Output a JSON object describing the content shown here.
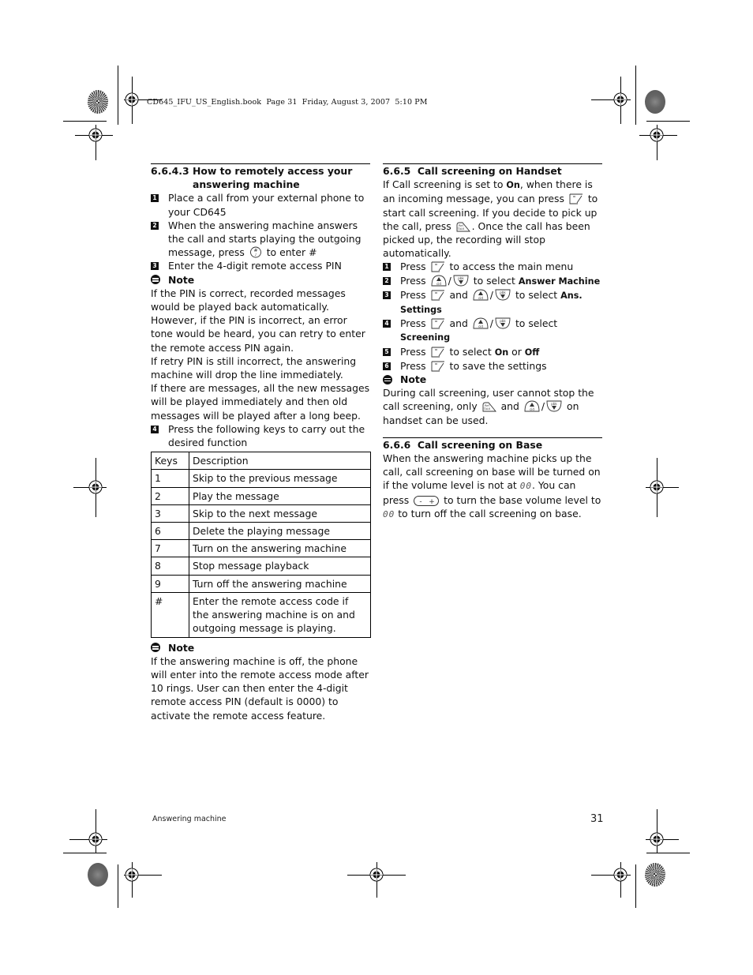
{
  "slug": "CD645_IFU_US_English.book  Page 31  Friday, August 3, 2007  5:10 PM",
  "left": {
    "section_number": "6.6.4.3",
    "section_title": "How to remotely access your answering machine",
    "steps": [
      {
        "n": "1",
        "text": "Place a call from your external phone to your CD645"
      },
      {
        "n": "2",
        "text_before": "When the answering machine answers the call and starts playing the outgoing message, press",
        "icon": "hash-key-icon",
        "text_after": "to enter #"
      },
      {
        "n": "3",
        "text": "Enter the 4-digit remote access PIN"
      }
    ],
    "note1": {
      "label": "Note",
      "paragraphs": [
        "If the PIN is correct, recorded messages would be played back automatically.",
        "However, if the PIN is incorrect, an error tone would be heard, you can retry to enter the remote access PIN again.",
        "If retry PIN is still incorrect, the answering machine will drop the line immediately.",
        "If there are messages, all the new messages will be played immediately and then old messages will be played after a long beep."
      ]
    },
    "step4": {
      "n": "4",
      "text": "Press the following keys to carry out the desired function"
    },
    "table": {
      "headers": [
        "Keys",
        "Description"
      ],
      "rows": [
        [
          "1",
          "Skip to the previous message"
        ],
        [
          "2",
          "Play the message"
        ],
        [
          "3",
          "Skip to the next message"
        ],
        [
          "6",
          "Delete the playing message"
        ],
        [
          "7",
          "Turn on the answering machine"
        ],
        [
          "8",
          "Stop message playback"
        ],
        [
          "9",
          "Turn off the answering machine"
        ],
        [
          "#",
          "Enter the remote access code if the answering machine is on and outgoing message is playing."
        ]
      ]
    },
    "note2": {
      "label": "Note",
      "text": "If the answering machine is off, the phone will enter into the remote access mode after 10 rings. User can then enter the 4-digit remote access PIN (default is 0000) to activate the remote access feature."
    }
  },
  "right": {
    "s665": {
      "number": "6.6.5",
      "title": "Call screening on Handset",
      "intro": {
        "t1": "If Call screening is set to ",
        "b1": "On",
        "t2": ", when there is an incoming message, you can press ",
        "t3": " to start call screening. If you decide to pick up the call, press ",
        "t4": ". Once the call has been picked up, the recording will stop automatically."
      },
      "steps": [
        {
          "n": "1",
          "a": "Press",
          "b": "to access the main menu"
        },
        {
          "n": "2",
          "a": "Press",
          "b": "to select",
          "bold": "Answer Machine"
        },
        {
          "n": "3",
          "a": "Press",
          "and": "and",
          "b": "to select",
          "bold": "Ans. Settings"
        },
        {
          "n": "4",
          "a": "Press",
          "and": "and",
          "b": "to select",
          "bold": "Screening"
        },
        {
          "n": "5",
          "a": "Press",
          "b": "to select",
          "bold1": "On",
          "or": "or",
          "bold2": "Off"
        },
        {
          "n": "6",
          "a": "Press",
          "b": "to save the settings"
        }
      ],
      "note": {
        "label": "Note",
        "t1": "During call screening, user cannot stop the call screening, only",
        "and": "and",
        "t2": "on handset can be used."
      }
    },
    "s666": {
      "number": "6.6.6",
      "title": "Call screening on Base",
      "t1": "When the answering machine picks up the call, call screening on base will be turned on if the volume level is not at",
      "t2": ". You can press",
      "t3": "to turn the base volume level to",
      "t4": "to turn off the call screening on base.",
      "lcd_value": "00"
    }
  },
  "footer": {
    "section": "Answering machine",
    "page": "31"
  }
}
